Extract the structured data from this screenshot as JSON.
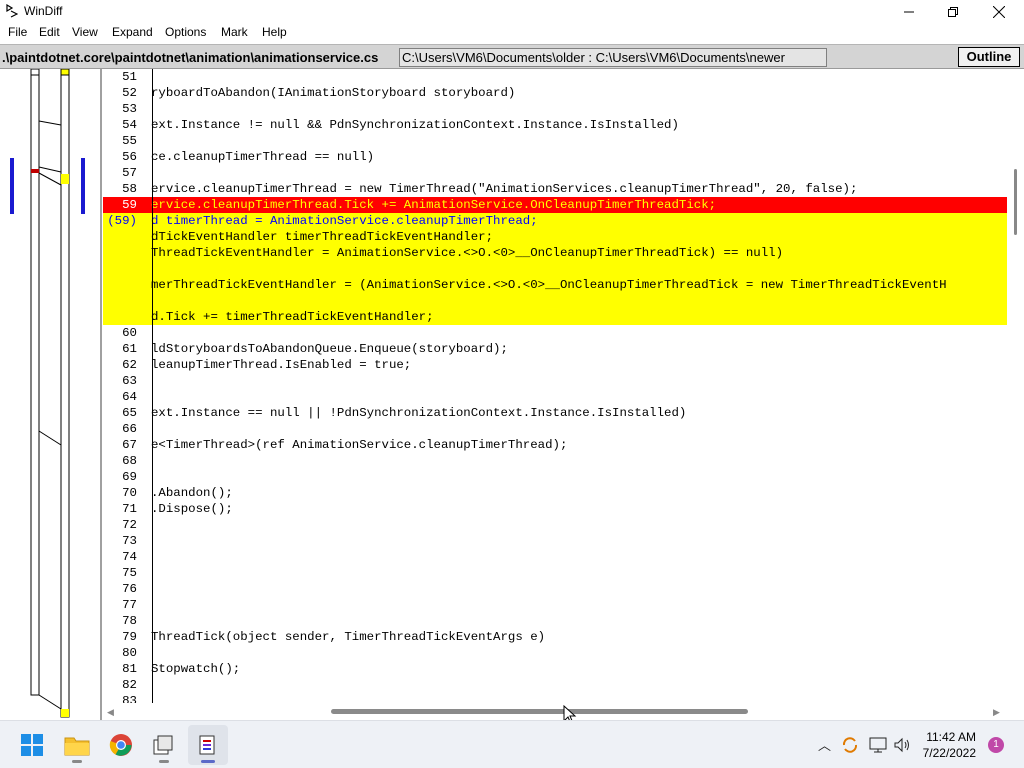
{
  "window": {
    "title": "WinDiff",
    "controls": [
      "minimize",
      "maximize",
      "close"
    ]
  },
  "menu": [
    "File",
    "Edit",
    "View",
    "Expand",
    "Options",
    "Mark",
    "Help"
  ],
  "pathbar": {
    "left_path": ".\\paintdotnet.core\\paintdotnet\\animation\\animationservice.cs",
    "compare_paths": "C:\\Users\\VM6\\Documents\\older : C:\\Users\\VM6\\Documents\\newer",
    "outline_button": "Outline"
  },
  "lines": [
    {
      "num": "51",
      "text": "",
      "style": "normal"
    },
    {
      "num": "52",
      "text": "ryboardToAbandon(IAnimationStoryboard storyboard)",
      "style": "normal"
    },
    {
      "num": "53",
      "text": "",
      "style": "normal"
    },
    {
      "num": "54",
      "text": "ext.Instance != null && PdnSynchronizationContext.Instance.IsInstalled)",
      "style": "normal"
    },
    {
      "num": "55",
      "text": "",
      "style": "normal"
    },
    {
      "num": "56",
      "text": "ce.cleanupTimerThread == null)",
      "style": "normal"
    },
    {
      "num": "57",
      "text": "",
      "style": "normal"
    },
    {
      "num": "58",
      "text": "ervice.cleanupTimerThread = new TimerThread(\"AnimationServices.cleanupTimerThread\", 20, false);",
      "style": "normal"
    },
    {
      "num": "59",
      "text": "ervice.cleanupTimerThread.Tick += AnimationService.OnCleanupTimerThreadTick;",
      "style": "red"
    },
    {
      "num": "(59)",
      "text": "d timerThread = AnimationService.cleanupTimerThread;",
      "style": "yellow-first"
    },
    {
      "num": "",
      "text": "dTickEventHandler timerThreadTickEventHandler;",
      "style": "yellow"
    },
    {
      "num": "",
      "text": "ThreadTickEventHandler = AnimationService.<>O.<0>__OnCleanupTimerThreadTick) == null)",
      "style": "yellow"
    },
    {
      "num": "",
      "text": "",
      "style": "yellow"
    },
    {
      "num": "",
      "text": "merThreadTickEventHandler = (AnimationService.<>O.<0>__OnCleanupTimerThreadTick = new TimerThreadTickEventH",
      "style": "yellow"
    },
    {
      "num": "",
      "text": "",
      "style": "yellow"
    },
    {
      "num": "",
      "text": "d.Tick += timerThreadTickEventHandler;",
      "style": "yellow"
    },
    {
      "num": "60",
      "text": "",
      "style": "normal"
    },
    {
      "num": "61",
      "text": "ldStoryboardsToAbandonQueue.Enqueue(storyboard);",
      "style": "normal"
    },
    {
      "num": "62",
      "text": "leanupTimerThread.IsEnabled = true;",
      "style": "normal"
    },
    {
      "num": "63",
      "text": "",
      "style": "normal"
    },
    {
      "num": "64",
      "text": "",
      "style": "normal"
    },
    {
      "num": "65",
      "text": "ext.Instance == null || !PdnSynchronizationContext.Instance.IsInstalled)",
      "style": "normal"
    },
    {
      "num": "66",
      "text": "",
      "style": "normal"
    },
    {
      "num": "67",
      "text": "e<TimerThread>(ref AnimationService.cleanupTimerThread);",
      "style": "normal"
    },
    {
      "num": "68",
      "text": "",
      "style": "normal"
    },
    {
      "num": "69",
      "text": "",
      "style": "normal"
    },
    {
      "num": "70",
      "text": ".Abandon();",
      "style": "normal"
    },
    {
      "num": "71",
      "text": ".Dispose();",
      "style": "normal"
    },
    {
      "num": "72",
      "text": "",
      "style": "normal"
    },
    {
      "num": "73",
      "text": "",
      "style": "normal"
    },
    {
      "num": "74",
      "text": "",
      "style": "normal"
    },
    {
      "num": "75",
      "text": "",
      "style": "normal"
    },
    {
      "num": "76",
      "text": "",
      "style": "normal"
    },
    {
      "num": "77",
      "text": "",
      "style": "normal"
    },
    {
      "num": "78",
      "text": "",
      "style": "normal"
    },
    {
      "num": "79",
      "text": "ThreadTick(object sender, TimerThreadTickEventArgs e)",
      "style": "normal"
    },
    {
      "num": "80",
      "text": "",
      "style": "normal"
    },
    {
      "num": "81",
      "text": "Stopwatch();",
      "style": "normal"
    },
    {
      "num": "82",
      "text": "",
      "style": "normal"
    },
    {
      "num": "83",
      "text": "",
      "style": "normal"
    }
  ],
  "colors": {
    "removed": "#ff0000",
    "added": "#ffff00",
    "moved_text": "#0000ff",
    "outline_bar": "#1a1ad0"
  },
  "taskbar": {
    "apps": [
      "start-icon",
      "file-explorer-icon",
      "chrome-icon",
      "task-view-icon",
      "windiff-icon"
    ],
    "clock_time": "11:42 AM",
    "clock_date": "7/22/2022",
    "notification_count": "1"
  }
}
